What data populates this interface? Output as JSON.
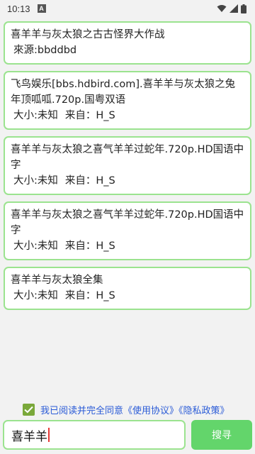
{
  "status_bar": {
    "time": "10:13",
    "notification_icon": "a-icon",
    "icons": [
      "wifi-icon",
      "signal-icon",
      "battery-icon"
    ]
  },
  "results": [
    {
      "title": "喜羊羊与灰太狼之古古怪界大作战",
      "meta": [
        "來源:bbddbd"
      ]
    },
    {
      "title": "飞鸟娱乐[bbs.hdbird.com].喜羊羊与灰太狼之兔年顶呱呱.720p.国粤双语",
      "meta": [
        "大小:未知",
        "来自：H_S"
      ]
    },
    {
      "title": "喜羊羊与灰太狼之喜气羊羊过蛇年.720p.HD国语中字",
      "meta": [
        "大小:未知",
        "来自：H_S"
      ]
    },
    {
      "title": "喜羊羊与灰太狼之喜气羊羊过蛇年.720p.HD国语中字",
      "meta": [
        "大小:未知",
        "来自：H_S"
      ]
    },
    {
      "title": "喜羊羊与灰太狼全集",
      "meta": [
        "大小:未知",
        "来自：H_S"
      ]
    }
  ],
  "agreement": {
    "checked": true,
    "text": "我已阅读并完全同意《使用协议》《隐私政策》"
  },
  "search": {
    "value": "喜羊羊",
    "button_label": "搜寻"
  },
  "colors": {
    "card_border": "#9be38f",
    "button": "#63d56b",
    "checkbox": "#7aa83a",
    "link": "#2a5bd7"
  }
}
